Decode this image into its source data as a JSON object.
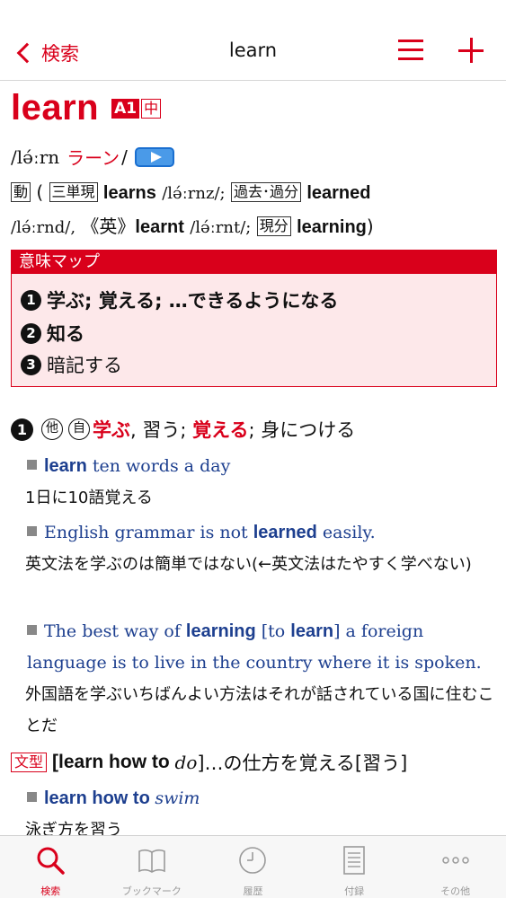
{
  "navbar": {
    "back_label": "検索",
    "title": "learn"
  },
  "entry": {
    "headword": "learn",
    "level_badge": "A1",
    "level_badge2": "中",
    "pronunciation": "/lə́ːrn",
    "pronunciation_kana": "ラーン",
    "slash": "/",
    "pos": "動",
    "forms": {
      "open_paren": "(",
      "third_label": "三単現",
      "third": "learns",
      "third_ipa": "/lə́ːrnz/;",
      "past_label": "過去･過分",
      "past": "learned",
      "past_ipa": "/lə́ːrnd/,",
      "british_label": "《英》",
      "british": "learnt",
      "british_ipa": "/lə́ːrnt/;",
      "present_label": "現分",
      "present": "learning",
      "close_paren": ")"
    }
  },
  "meaning_map": {
    "header": "意味マップ",
    "items": [
      {
        "num": "1",
        "text": "学ぶ; 覚える; …できるようになる"
      },
      {
        "num": "2",
        "text": "知る"
      },
      {
        "num": "3",
        "text": "暗記する"
      }
    ]
  },
  "sense1": {
    "num": "1",
    "tag1": "他",
    "tag2": "自",
    "m1": "学ぶ",
    "sep1": ", 習う; ",
    "m2": "覚える",
    "sep2": "; 身につける"
  },
  "examples": [
    {
      "bold": "learn",
      "rest": " ten words a day",
      "ja": "1日に10語覚える"
    },
    {
      "pre": "English grammar is not ",
      "bold": "learned",
      "rest": " easily.",
      "ja": "英文法を学ぶのは簡単ではない(←英文法はたやすく学べない)"
    },
    {
      "pre": "The best way of ",
      "bold": "learning",
      "mid": " [to ",
      "bold2": "learn",
      "rest": "] a foreign language is to live in the country where it is spoken.",
      "ja": "外国語を学ぶいちばんよい方法はそれが話されている国に住むことだ"
    }
  ],
  "pattern": {
    "label": "文型",
    "bold": "[learn how to ",
    "italic": "do",
    "rest": "]…の仕方を覚える[習う]"
  },
  "example4": {
    "bold": "learn how to ",
    "italic": "swim",
    "ja": "泳ぎ方を習う"
  },
  "tabbar": {
    "tabs": [
      {
        "label": "検索"
      },
      {
        "label": "ブックマーク"
      },
      {
        "label": "履歴"
      },
      {
        "label": "付録"
      },
      {
        "label": "その他"
      }
    ]
  },
  "colors": {
    "accent": "#d9001b",
    "example_blue": "#1d3f8f",
    "meaning_map_bg": "#fde8ea"
  }
}
